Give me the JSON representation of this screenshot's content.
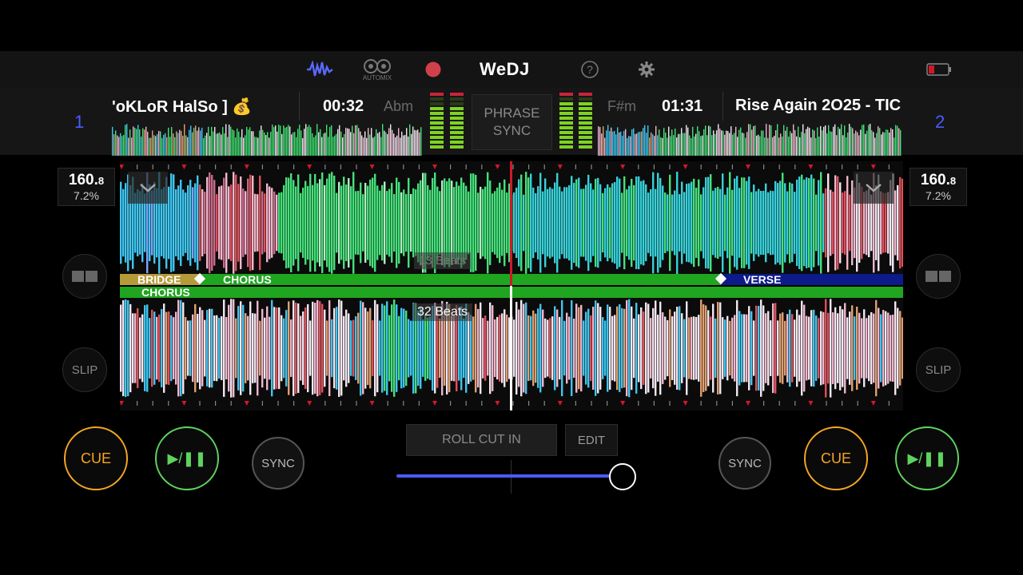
{
  "app": {
    "brand": "WeDJ"
  },
  "toolbar": {
    "waveform_icon": "waveform-icon",
    "automix_label": "AUTOMIX",
    "record_icon": "record-icon",
    "help_icon": "help-icon",
    "settings_icon": "gear-icon",
    "battery_icon": "battery-low-icon"
  },
  "deck1": {
    "number": "1",
    "title": "'oKLoR HalSo ] 💰",
    "time": "00:32",
    "key": "Abm",
    "bpm_main": "160.",
    "bpm_dec": "8",
    "pitch": "7.2%",
    "phrase_labels": [
      "BRIDGE",
      "CHORUS"
    ],
    "beats_label": "13 Beats"
  },
  "deck2": {
    "number": "2",
    "title": "Rise Again 2O25 - TIC",
    "time": "01:31",
    "key": "F#m",
    "bpm_main": "160.",
    "bpm_dec": "8",
    "pitch": "7.2%",
    "phrase_labels": [
      "CHORUS",
      "VERSE"
    ],
    "beats_label": "32 Beats"
  },
  "center": {
    "phrase_sync_line1": "PHRASE",
    "phrase_sync_line2": "SYNC",
    "roll_cut_label": "ROLL CUT IN",
    "edit_label": "EDIT"
  },
  "buttons": {
    "cue": "CUE",
    "play": "▶/❚❚",
    "sync": "SYNC",
    "slip": "SLIP"
  },
  "colors": {
    "accent_blue": "#4a5cff",
    "cue_orange": "#f5a623",
    "play_green": "#5fd35f",
    "phrase_green": "#1fa51f",
    "bridge_gold": "#b59a3a",
    "verse_navy": "#0c1a8a",
    "playhead_red": "#d0182a"
  }
}
